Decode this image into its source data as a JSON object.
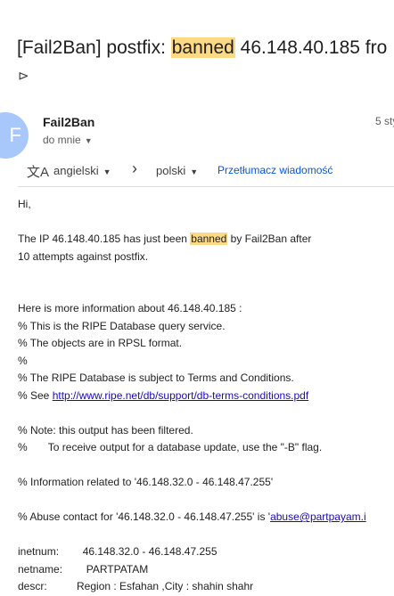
{
  "subject": {
    "prefix": "[Fail2Ban] postfix: ",
    "highlight": "banned",
    "suffix": " 46.148.40.185 fro"
  },
  "avatar_initial": "F",
  "sender": {
    "name": "Fail2Ban",
    "to_label": "do mnie",
    "date": "5 sty"
  },
  "translate": {
    "source_lang": "angielski",
    "target_lang": "polski",
    "translate_link": "Przetłumacz wiadomość"
  },
  "body": {
    "greeting": "Hi,",
    "p1_a": "The IP 46.148.40.185 has just been ",
    "p1_hl": "banned",
    "p1_b": " by Fail2Ban after",
    "p1_c": "10 attempts against postfix.",
    "l1": "Here is more information about 46.148.40.185 :",
    "l2": "% This is the RIPE Database query service.",
    "l3": "% The objects are in RPSL format.",
    "l4": "%",
    "l5": "% The RIPE Database is subject to Terms and Conditions.",
    "l6_a": "% See ",
    "l6_link": "http://www.ripe.net/db/support/db-terms-conditions.pdf",
    "l7": "% Note: this output has been filtered.",
    "l8": "%       To receive output for a database update, use the \"-B\" flag.",
    "l9": "% Information related to '46.148.32.0 - 46.148.47.255'",
    "l10_a": "% Abuse contact for '46.148.32.0 - 46.148.47.255' is '",
    "l10_link": "abuse@partpayam.i",
    "l11": "inetnum:        46.148.32.0 - 46.148.47.255",
    "l12": "netname:        PARTPATAM",
    "l13": "descr:          Region : Esfahan ,City : shahin shahr"
  }
}
